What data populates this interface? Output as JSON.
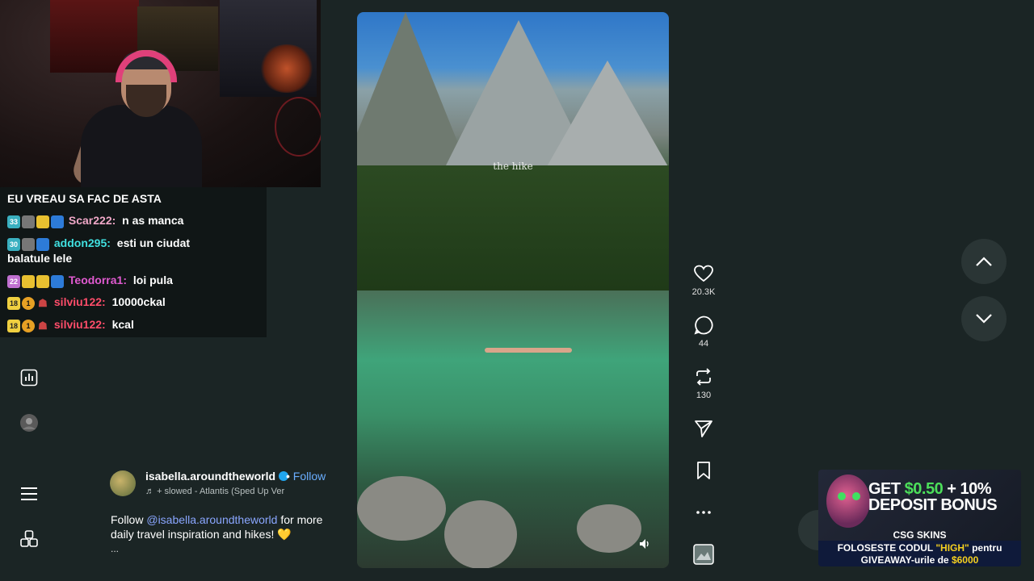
{
  "chat": {
    "messages": [
      {
        "user": "",
        "text": "EU VREAU SA FAC DE ASTA",
        "user_color": "#ffffff",
        "badges": []
      },
      {
        "user": "Scar222:",
        "text": "n as manca",
        "user_color": "#f0a8c8",
        "badges": [
          "33"
        ]
      },
      {
        "user": "addon295:",
        "text": "esti un ciudat",
        "text_cont": "balatule lele",
        "user_color": "#40e0e0",
        "badges": [
          "30"
        ]
      },
      {
        "user": "Teodorra1:",
        "text": "loi pula",
        "user_color": "#e05ad0",
        "badges": [
          "22"
        ]
      },
      {
        "user": "silviu122:",
        "text": "10000ckal",
        "user_color": "#ff4d6a",
        "badges": [
          "18",
          "1"
        ]
      },
      {
        "user": "silviu122:",
        "text": "kcal",
        "user_color": "#ff4d6a",
        "badges": [
          "18",
          "1"
        ]
      }
    ]
  },
  "video": {
    "caption_overlay": "the hike"
  },
  "actions": {
    "likes": "20.3K",
    "comments": "44",
    "reposts": "130"
  },
  "post": {
    "username": "isabella.aroundtheworld",
    "separator": "•",
    "follow_label": "Follow",
    "music": "+ slowed - Atlantis (Sped Up Ver",
    "desc_prefix": "Follow ",
    "mention": "@isabella.aroundtheworld",
    "desc_suffix": " for more daily travel inspiration and hikes! 💛",
    "more": "..."
  },
  "ad": {
    "headline_1": "GET ",
    "headline_amount": "$0.50",
    "headline_2": " + 10%",
    "headline_3": "DEPOSIT BONUS",
    "brand": "CSG SKINS",
    "line1_prefix": "FOLOSESTE CODUL ",
    "line1_code": "\"HIGH\"",
    "line1_suffix": " pentru",
    "line2_prefix": "GIVEAWAY-urile de ",
    "line2_amount": "$6000"
  },
  "colors": {
    "background": "#1b2525",
    "accent_link": "#6aaeff",
    "verified": "#20a6f0"
  }
}
